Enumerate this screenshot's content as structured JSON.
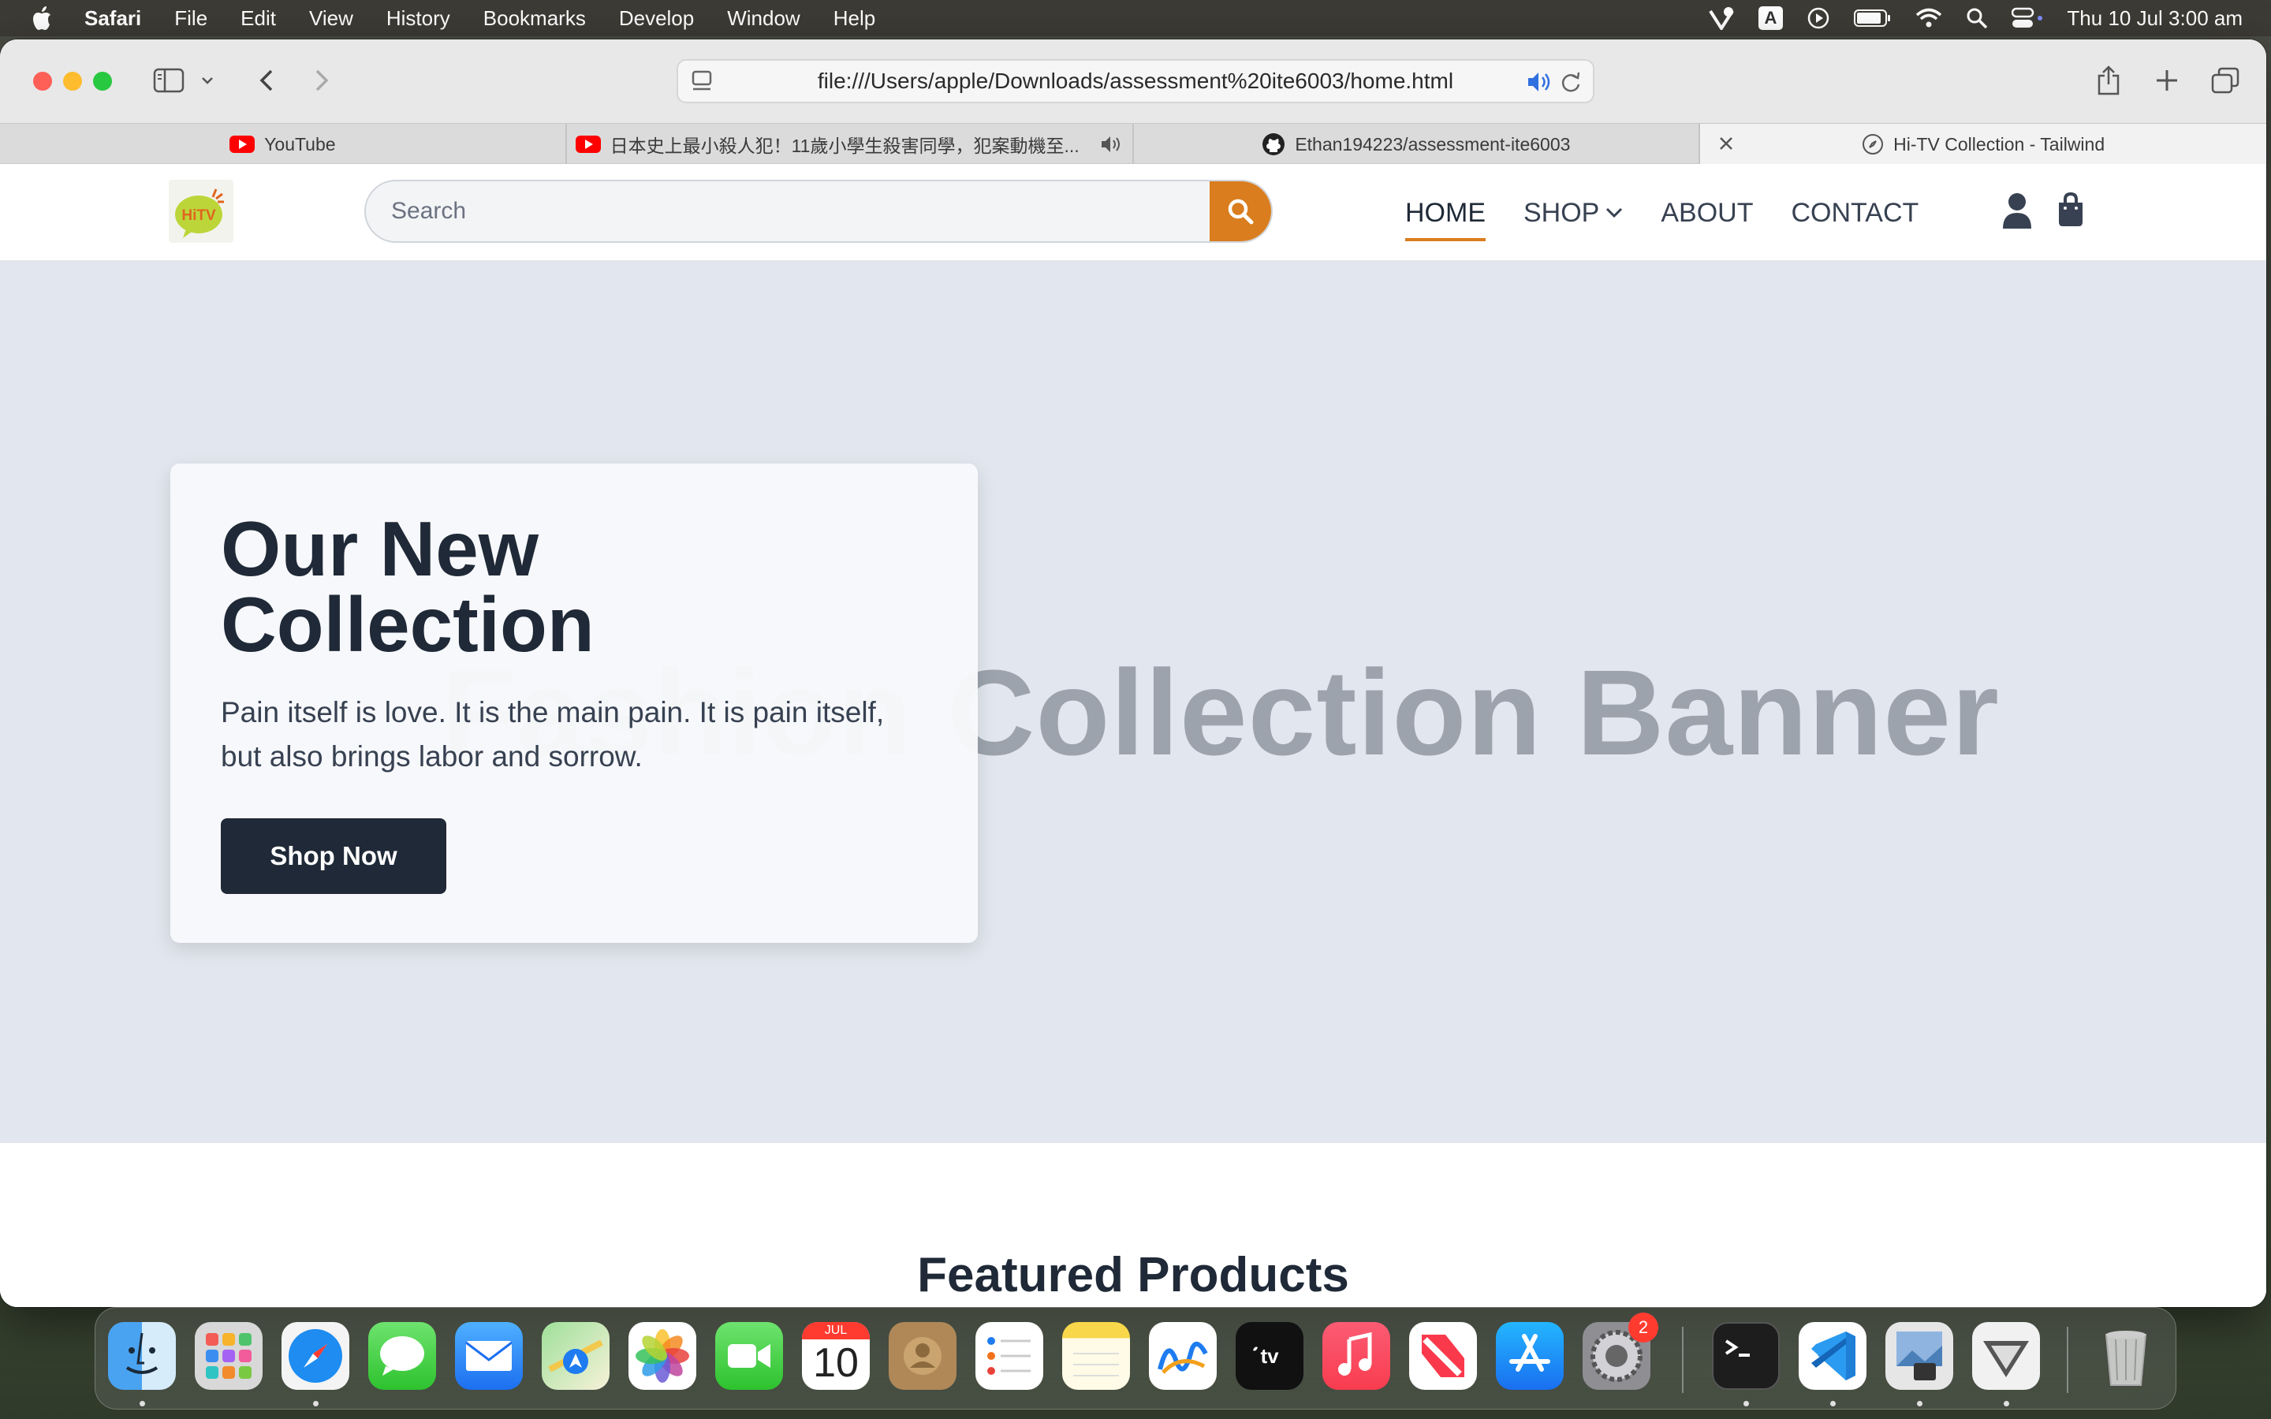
{
  "menubar": {
    "app_name": "Safari",
    "menus": [
      "File",
      "Edit",
      "View",
      "History",
      "Bookmarks",
      "Develop",
      "Window",
      "Help"
    ],
    "input_indicator": "A",
    "clock": "Thu 10 Jul  3:00 am"
  },
  "browser": {
    "url": "file:///Users/apple/Downloads/assessment%20ite6003/home.html",
    "tabs": [
      {
        "title": "YouTube",
        "icon": "youtube-icon"
      },
      {
        "title": "日本史上最小殺人犯！11歲小學生殺害同學，犯案動機至...",
        "icon": "youtube-icon"
      },
      {
        "title": "Ethan194223/assessment-ite6003",
        "icon": "github-icon"
      },
      {
        "title": "Hi-TV Collection - Tailwind",
        "icon": "compass-icon"
      }
    ]
  },
  "site": {
    "logo_text": "HiTV",
    "search_placeholder": "Search",
    "nav": {
      "home": "HOME",
      "shop": "SHOP",
      "about": "ABOUT",
      "contact": "CONTACT"
    },
    "hero": {
      "banner_alt": "Fashion Collection Banner",
      "title": "Our New Collection",
      "text": "Pain itself is love. It is the main pain. It is pain itself, but also brings labor and sorrow.",
      "button": "Shop Now"
    },
    "featured_title": "Featured Products"
  },
  "dock": {
    "calendar_month": "JUL",
    "calendar_day": "10",
    "settings_badge": "2",
    "apps": [
      "finder-icon",
      "launchpad-icon",
      "safari-icon",
      "messages-icon",
      "mail-icon",
      "maps-icon",
      "photos-icon",
      "facetime-icon",
      "calendar-icon",
      "contacts-icon",
      "reminders-icon",
      "notes-icon",
      "freeform-icon",
      "tv-icon",
      "music-icon",
      "news-icon",
      "app-store-icon",
      "system-settings-icon",
      "terminal-icon",
      "vscode-icon",
      "preview-icon",
      "vpn-icon",
      "trash-icon"
    ]
  }
}
